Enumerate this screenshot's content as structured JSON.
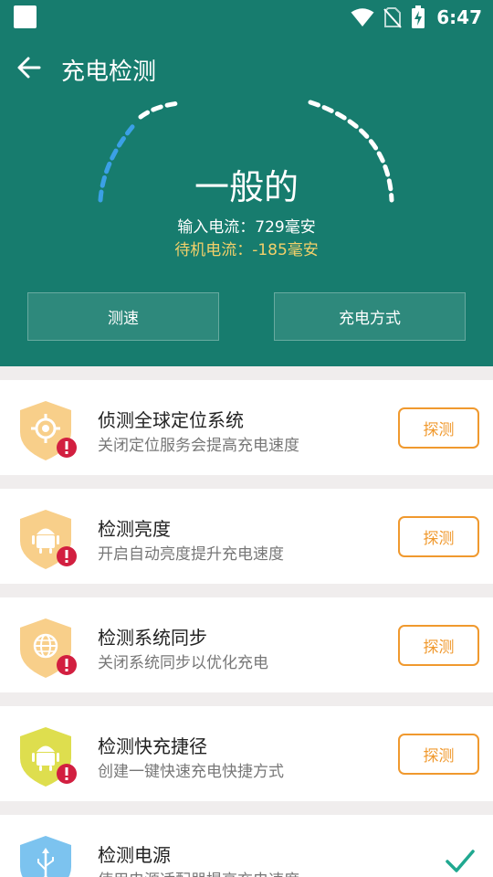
{
  "status_bar": {
    "time": "6:47"
  },
  "app_bar": {
    "title": "充电检测"
  },
  "gauge": {
    "status": "一般的",
    "input_current": "输入电流：729毫安",
    "standby_current": "待机电流：-185毫安"
  },
  "buttons": {
    "speed": "测速",
    "charge_mode": "充电方式"
  },
  "colors": {
    "header": "#177c6e",
    "accent_orange": "#f0992e",
    "standby_yellow": "#f3d06a",
    "check_green": "#20a890",
    "badge_red": "#d21f40"
  },
  "items": [
    {
      "title": "侦测全球定位系统",
      "desc": "关闭定位服务会提高充电速度",
      "action": "探测",
      "icon": "gps-shield-icon"
    },
    {
      "title": "检测亮度",
      "desc": "开启自动亮度提升充电速度",
      "action": "探测",
      "icon": "android-shield-icon"
    },
    {
      "title": "检测系统同步",
      "desc": "关闭系统同步以优化充电",
      "action": "探测",
      "icon": "globe-shield-icon"
    },
    {
      "title": "检测快充捷径",
      "desc": "创建一键快速充电快捷方式",
      "action": "探测",
      "icon": "android-shield-icon"
    },
    {
      "title": "检测电源",
      "desc": "使用电源适配器提高充电速度",
      "icon": "usb-shield-icon",
      "status_icon": "check-icon"
    }
  ]
}
